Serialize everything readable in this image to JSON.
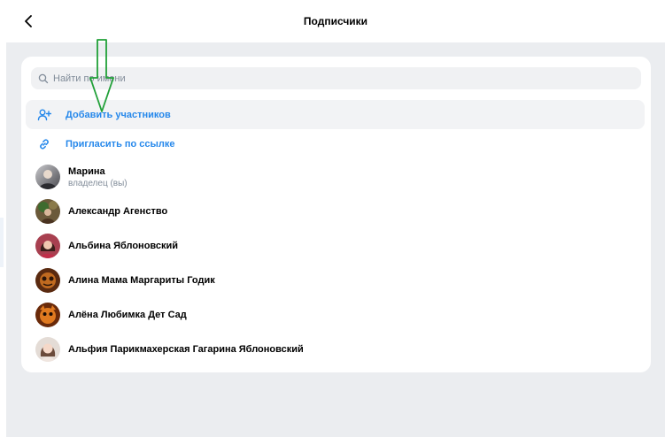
{
  "header": {
    "title": "Подписчики"
  },
  "search": {
    "placeholder": "Найти по имени"
  },
  "actions": [
    {
      "label": "Добавить участников",
      "icon": "add-user-icon"
    },
    {
      "label": "Пригласить по ссылке",
      "icon": "link-icon"
    }
  ],
  "members": [
    {
      "name": "Марина",
      "sub": "владелец (вы)"
    },
    {
      "name": "Александр Агенство",
      "sub": ""
    },
    {
      "name": "Альбина Яблоновский",
      "sub": ""
    },
    {
      "name": "Алина Мама Маргариты Годик",
      "sub": ""
    },
    {
      "name": "Алёна Любимка Дет Сад",
      "sub": ""
    },
    {
      "name": "Альфия Парикмахерская Гагарина Яблоновский",
      "sub": ""
    }
  ],
  "colors": {
    "accent": "#2688eb",
    "annotation": "#21a038",
    "background": "#ebedf0"
  }
}
